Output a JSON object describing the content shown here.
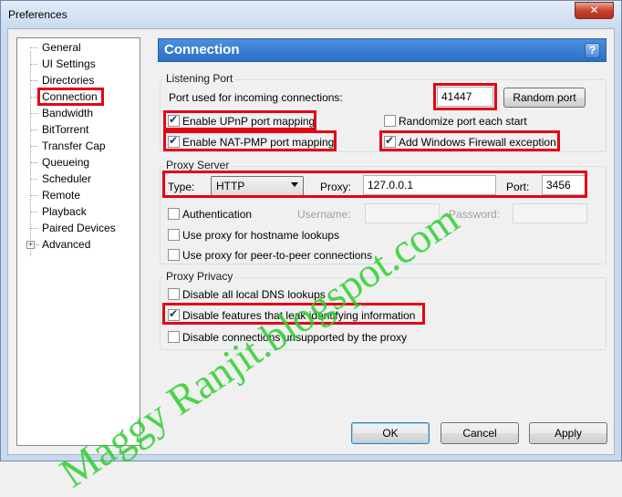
{
  "window": {
    "title": "Preferences",
    "close_glyph": "✕"
  },
  "tree": {
    "items": [
      {
        "label": "General"
      },
      {
        "label": "UI Settings"
      },
      {
        "label": "Directories"
      },
      {
        "label": "Connection",
        "selected": true
      },
      {
        "label": "Bandwidth"
      },
      {
        "label": "BitTorrent"
      },
      {
        "label": "Transfer Cap"
      },
      {
        "label": "Queueing"
      },
      {
        "label": "Scheduler"
      },
      {
        "label": "Remote"
      },
      {
        "label": "Playback"
      },
      {
        "label": "Paired Devices"
      },
      {
        "label": "Advanced",
        "expandable": true
      }
    ],
    "expander_glyph": "+"
  },
  "header": {
    "title": "Connection",
    "help_glyph": "?"
  },
  "listening_port": {
    "group_title": "Listening Port",
    "port_label": "Port used for incoming connections:",
    "port_value": "41447",
    "random_port_label": "Random port",
    "enable_upnp": {
      "label": "Enable UPnP port mapping",
      "checked": true
    },
    "randomize_port": {
      "label": "Randomize port each start",
      "checked": false
    },
    "enable_natpmp": {
      "label": "Enable NAT-PMP port mapping",
      "checked": true
    },
    "firewall_exception": {
      "label": "Add Windows Firewall exception",
      "checked": true
    }
  },
  "proxy_server": {
    "group_title": "Proxy Server",
    "type_label": "Type:",
    "type_value": "HTTP",
    "proxy_label": "Proxy:",
    "proxy_value": "127.0.0.1",
    "port_label": "Port:",
    "port_value": "3456",
    "authentication": {
      "label": "Authentication",
      "checked": false
    },
    "username_label": "Username:",
    "password_label": "Password:",
    "hostname_lookups": {
      "label": "Use proxy for hostname lookups",
      "checked": false
    },
    "peer_connections": {
      "label": "Use proxy for peer-to-peer connections",
      "checked": false
    }
  },
  "proxy_privacy": {
    "group_title": "Proxy Privacy",
    "disable_dns": {
      "label": "Disable all local DNS lookups",
      "checked": false
    },
    "disable_leak": {
      "label": "Disable features that leak identifying information",
      "checked": true
    },
    "disable_unsupported": {
      "label": "Disable connections unsupported by the proxy",
      "checked": false
    }
  },
  "buttons": {
    "ok": "OK",
    "cancel": "Cancel",
    "apply": "Apply"
  },
  "watermark": "Maggy Ranjit.blogspot.com",
  "colors": {
    "highlight_box": "#e30613",
    "header_blue": "#2a6fc7",
    "watermark_green": "#2fd02f"
  }
}
